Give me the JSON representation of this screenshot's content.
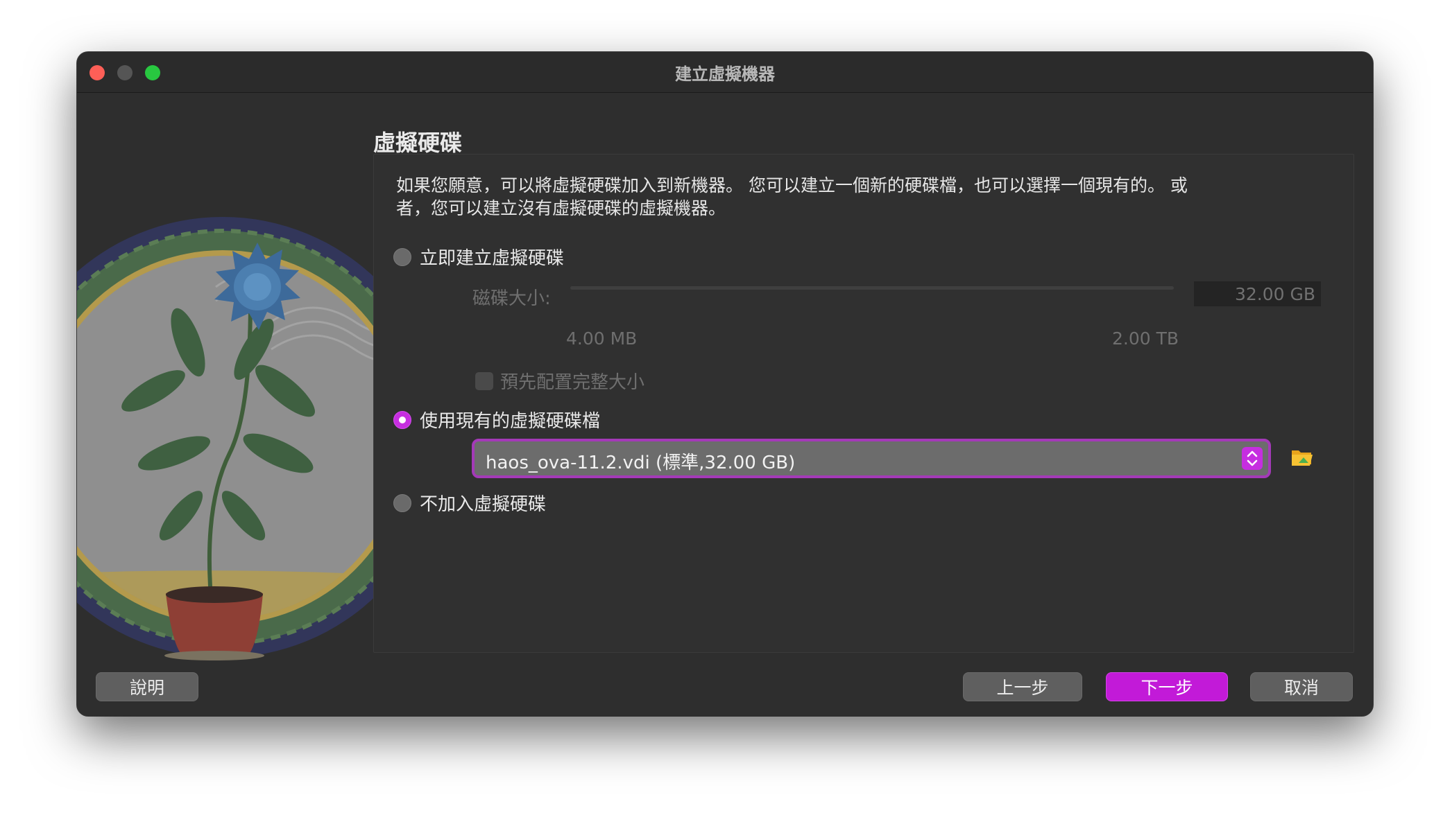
{
  "window": {
    "title": "建立虛擬機器"
  },
  "page": {
    "heading": "虛擬硬碟",
    "description": "如果您願意，可以將虛擬硬碟加入到新機器。 您可以建立一個新的硬碟檔，也可以選擇一個現有的。 或者，您可以建立沒有虛擬硬碟的虛擬機器。"
  },
  "options": {
    "create_new": {
      "label": "立即建立虛擬硬碟",
      "checked": false
    },
    "use_existing": {
      "label": "使用現有的虛擬硬碟檔",
      "checked": true
    },
    "no_disk": {
      "label": "不加入虛擬硬碟",
      "checked": false
    }
  },
  "disk_size": {
    "label": "磁碟大小:",
    "value": "32.00 GB",
    "min_label": "4.00 MB",
    "max_label": "2.00 TB",
    "enabled": false
  },
  "prealloc": {
    "label": "預先配置完整大小",
    "checked": false,
    "enabled": false
  },
  "existing_file": {
    "selected": "haos_ova-11.2.vdi (標準,32.00 GB)"
  },
  "buttons": {
    "help": "說明",
    "back": "上一步",
    "next": "下一步",
    "cancel": "取消"
  },
  "colors": {
    "accent": "#c21ad8",
    "window_bg": "#2e2e2e"
  }
}
